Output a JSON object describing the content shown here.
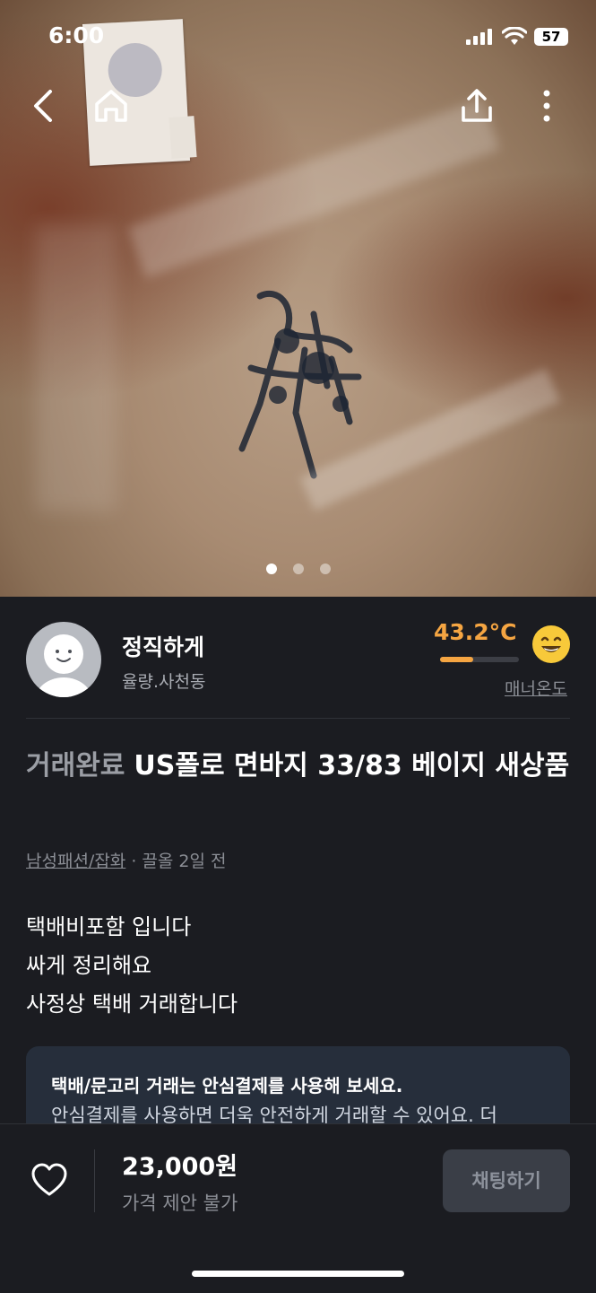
{
  "status_bar": {
    "time": "6:00",
    "battery": "57"
  },
  "seller": {
    "name": "정직하게",
    "location": "율량.사천동",
    "temperature": "43.2°C",
    "temperature_fill_percent": 42,
    "manner_label": "매너온도"
  },
  "listing": {
    "state": "거래완료",
    "title": "US폴로 면바지 33/83 베이지 새상품",
    "category": "남성패션/잡화",
    "time_ago": " · 끌올 2일 전",
    "description_lines": [
      "택배비포함 입니다",
      "싸게 정리해요",
      "사정상 택배 거래합니다"
    ]
  },
  "safe_payment": {
    "title": "택배/문고리 거래는 안심결제를 사용해 보세요.",
    "body": "안심결제를 사용하면 더욱 안전하게 거래할 수 있어요. 더"
  },
  "bottom_bar": {
    "price": "23,000원",
    "price_note": "가격 제안 불가",
    "chat_label": "채팅하기"
  },
  "photo_pager": {
    "count": 3,
    "active_index": 0
  },
  "colors": {
    "accent_temperature": "#f5a542",
    "background": "#1b1c21"
  },
  "icons": [
    "back-icon",
    "home-icon",
    "share-icon",
    "more-icon",
    "heart-icon",
    "smile-emoji-icon"
  ]
}
